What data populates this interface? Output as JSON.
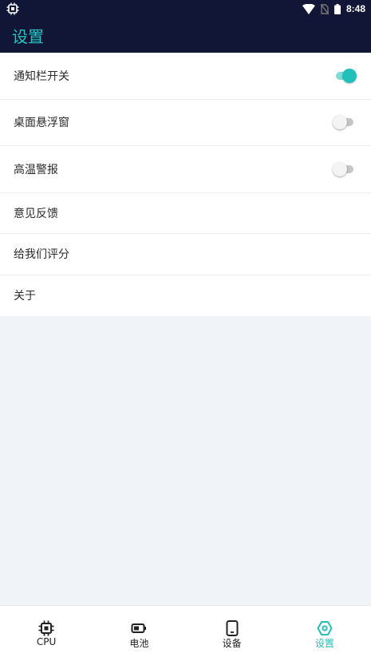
{
  "status_bar": {
    "time": "8:48",
    "app_icon": "cpu-chip-icon",
    "icons": [
      "wifi-icon",
      "no-sim-icon",
      "battery-icon"
    ]
  },
  "app_bar": {
    "title": "设置"
  },
  "settings": {
    "items": [
      {
        "label": "通知栏开关",
        "toggle": true,
        "enabled": true
      },
      {
        "label": "桌面悬浮窗",
        "toggle": true,
        "enabled": false
      },
      {
        "label": "高温警报",
        "toggle": true,
        "enabled": false
      },
      {
        "label": "意见反馈"
      },
      {
        "label": "给我们评分"
      },
      {
        "label": "关于"
      }
    ]
  },
  "bottom_nav": {
    "items": [
      {
        "label": "CPU",
        "icon": "cpu-chip-icon",
        "active": false
      },
      {
        "label": "电池",
        "icon": "battery-icon",
        "active": false
      },
      {
        "label": "设备",
        "icon": "phone-device-icon",
        "active": false
      },
      {
        "label": "设置",
        "icon": "settings-hexagon-icon",
        "active": true
      }
    ]
  },
  "colors": {
    "header_bg": "#111637",
    "accent": "#1fc1b8",
    "page_bg": "#f0f3f7"
  }
}
